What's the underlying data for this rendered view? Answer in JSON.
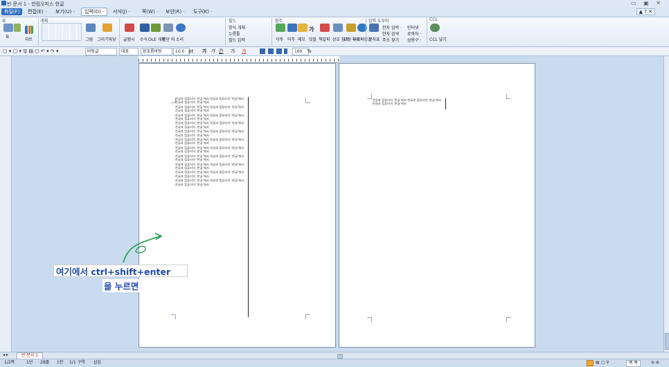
{
  "window": {
    "title": "빈 문서 1 - 한컴오피스 한글",
    "controls": "▭ ▣ ✕"
  },
  "menus": [
    {
      "label": "파일(F)"
    },
    {
      "label": "편집(E) ·"
    },
    {
      "label": "보기(U) ·"
    },
    {
      "label": "입력(D) ·"
    },
    {
      "label": "서식(J) ·"
    },
    {
      "label": "쪽(W) ·"
    },
    {
      "label": "보안(R) ·"
    },
    {
      "label": "도구(K) ·"
    }
  ],
  "help": "▲ ? ✕",
  "ribbon": {
    "groups": [
      {
        "title": "표"
      },
      {
        "title": "개체"
      },
      {
        "title": "필드"
      },
      {
        "title": "참조"
      },
      {
        "title": "입력 도우미"
      },
      {
        "title": "CCL"
      }
    ],
    "labels": {
      "table": "표",
      "chart": "차트",
      "picture": "그림",
      "drawing": "그리기마당",
      "clipart": "글맵시",
      "equation": "수식",
      "ole": "OLE 개체",
      "hyperlink_obj": "문단 띠",
      "sound": "소리",
      "field1": "양식 개체 ·",
      "field2": "누름틀",
      "field3": "필드 입력",
      "ref1": "각주",
      "ref2": "미주",
      "ref3": "메모",
      "ref4": "덧말",
      "ref5": "책갈피",
      "ref6": "상호 참조",
      "ref7": "교정 부호 ·",
      "hyperlink": "하이퍼링크",
      "helper1": "한자 입력 ·",
      "helper2": "한자 검색",
      "helper3": "주소 찾기",
      "helper4": "인터넷",
      "helper5": "로마자 ·",
      "helper6": "상용구 ·",
      "special": "문자표",
      "ccl": "CCL 넣기"
    }
  },
  "toolbar": {
    "style": "바탕글",
    "lang": "대표",
    "font": "함초롬바탕",
    "size": "10.0",
    "unit": "pt",
    "bold": "가",
    "italic": "가",
    "underline": "간",
    "strike": "가",
    "color": "가",
    "zoom": "160",
    "zoom_unit": "%"
  },
  "page1_text": [
    "한글과 컴퓨터의 '한글'에서 ",
    "한글과 컴퓨터의 '한글'에서 ",
    "한글과 컴퓨터의 '한글'에서 "
  ],
  "tab": {
    "label": "빈 문서 1"
  },
  "status": {
    "page": "1/2쪽",
    "section": "1단",
    "line": "28줄",
    "col": "1칸",
    "pos": "1/1 구역",
    "mode": "삽입",
    "zoom_label": "쪽 폭"
  },
  "annotation": {
    "line1": "여기에서 ctrl+shift+enter",
    "line2": "을 누르면"
  },
  "colors": {
    "accent": "#2f6ec1",
    "annot": "#1e4aa8",
    "arrow": "#1a9a4a"
  }
}
